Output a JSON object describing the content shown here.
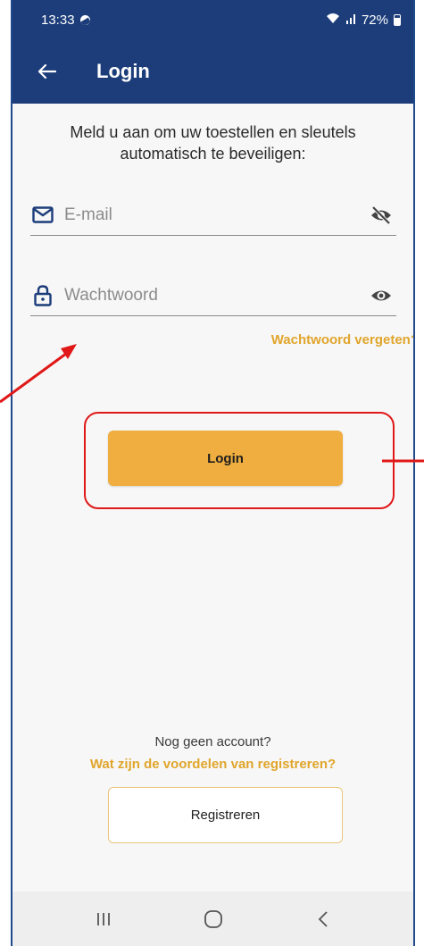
{
  "status_bar": {
    "time": "13:33",
    "battery": "72%"
  },
  "app_bar": {
    "title": "Login"
  },
  "intro_text": "Meld u aan om uw toestellen en sleutels automatisch te beveiligen:",
  "email_field": {
    "placeholder": "E-mail",
    "value": ""
  },
  "password_field": {
    "placeholder": "Wachtwoord",
    "value": ""
  },
  "forgot_password": "Wachtwoord vergeten?",
  "login_button": "Login",
  "no_account": "Nog geen account?",
  "benefits_link": "Wat zijn de voordelen van registreren?",
  "register_button": "Registreren",
  "colors": {
    "brand_blue": "#1c3d7a",
    "accent_orange": "#efae3f",
    "link_orange": "#e0a52b",
    "annotation_red": "#e01818"
  },
  "icons": [
    "back-arrow-icon",
    "mail-icon",
    "eye-slash-icon",
    "lock-icon",
    "eye-icon",
    "recents-icon",
    "home-icon",
    "back-nav-icon"
  ]
}
